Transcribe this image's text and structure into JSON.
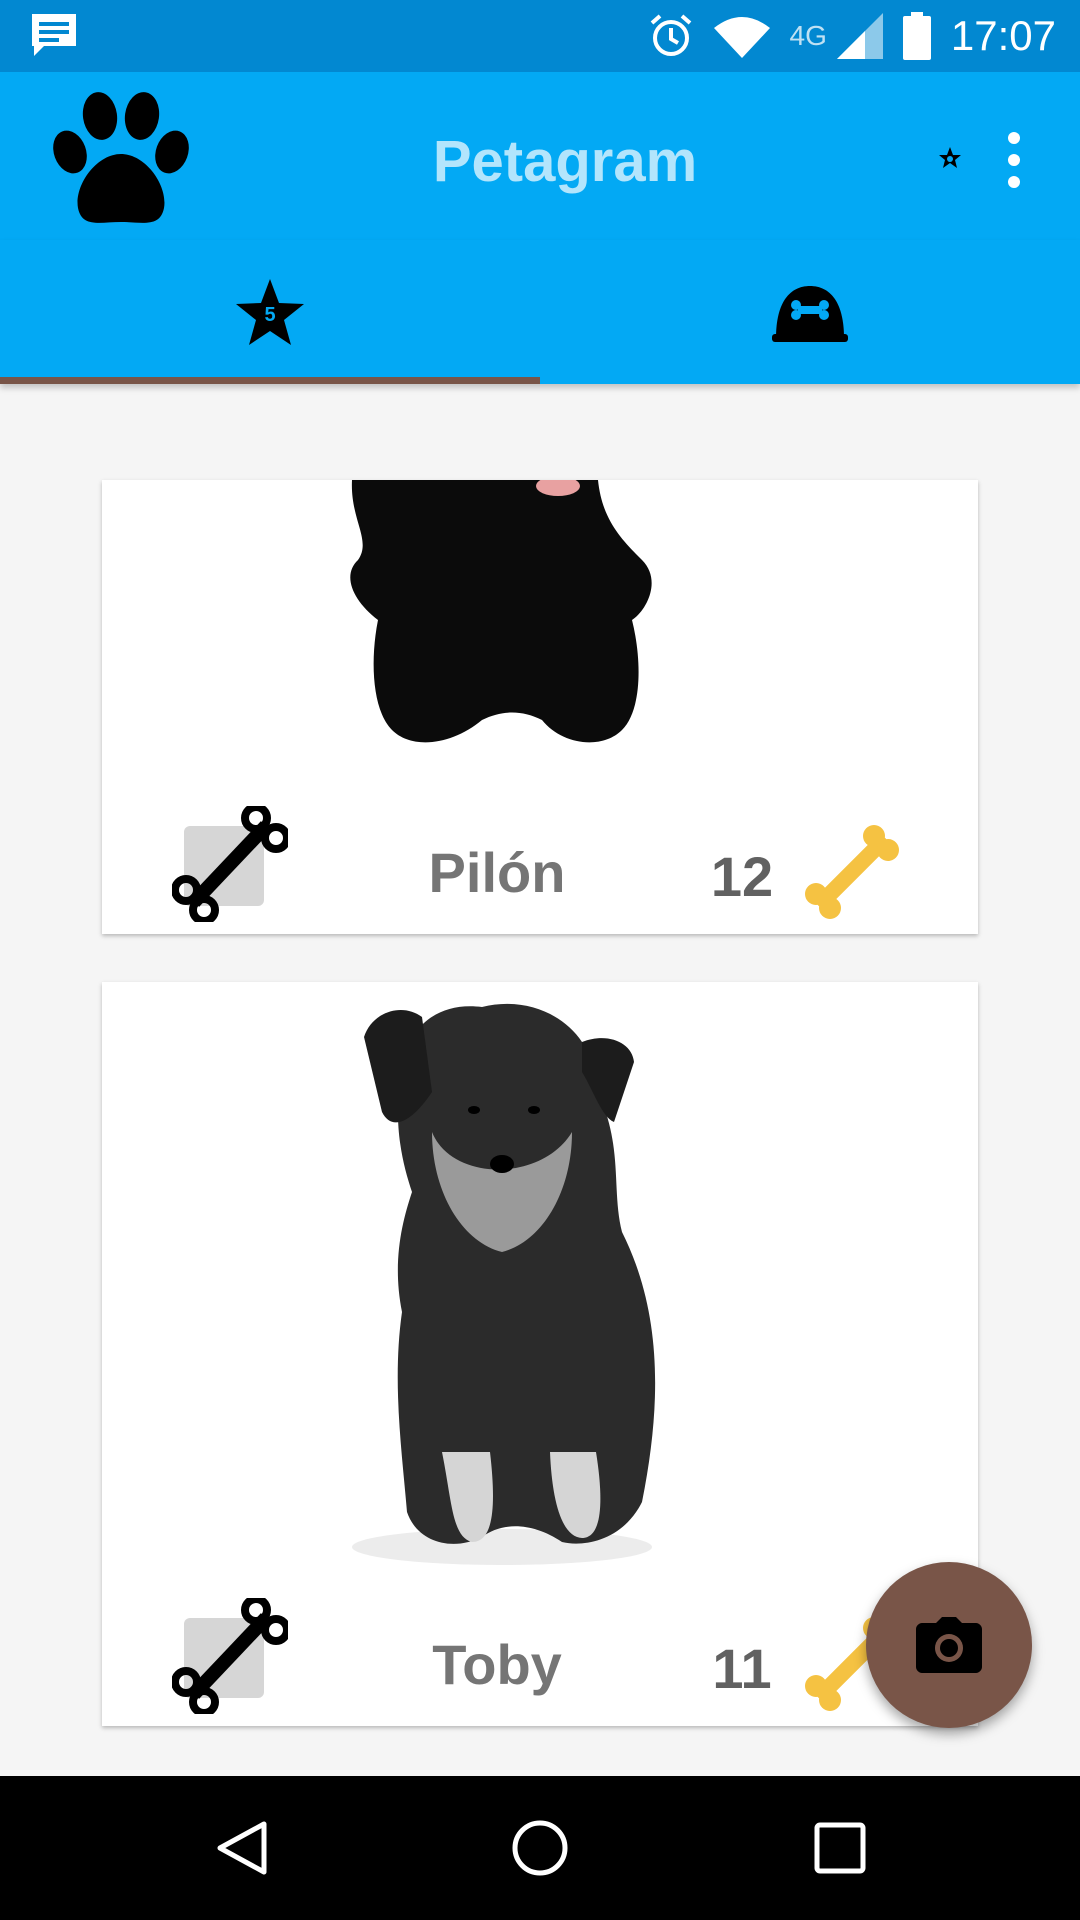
{
  "status_bar": {
    "time": "17:07",
    "network": "4G",
    "icons": [
      "message-icon",
      "alarm-icon",
      "wifi-icon",
      "signal-icon",
      "battery-icon"
    ]
  },
  "toolbar": {
    "title": "Petagram",
    "icons": [
      "paw-icon",
      "favorite-star-icon",
      "overflow-menu-icon"
    ]
  },
  "tabs": [
    {
      "icon": "star-icon",
      "badge": "5",
      "selected": true
    },
    {
      "icon": "dog-bowl-icon",
      "selected": false
    }
  ],
  "pets": [
    {
      "name": "Pilón",
      "likes": "12"
    },
    {
      "name": "Toby",
      "likes": "11"
    }
  ],
  "fab": {
    "icon": "camera-icon"
  },
  "navigation": {
    "icons": [
      "back-icon",
      "home-icon",
      "recents-icon"
    ]
  },
  "colors": {
    "status_bar": "#0288d1",
    "primary": "#03a9f4",
    "title_text": "#b3e5fc",
    "accent": "#795548",
    "bone": "#f5c242"
  }
}
